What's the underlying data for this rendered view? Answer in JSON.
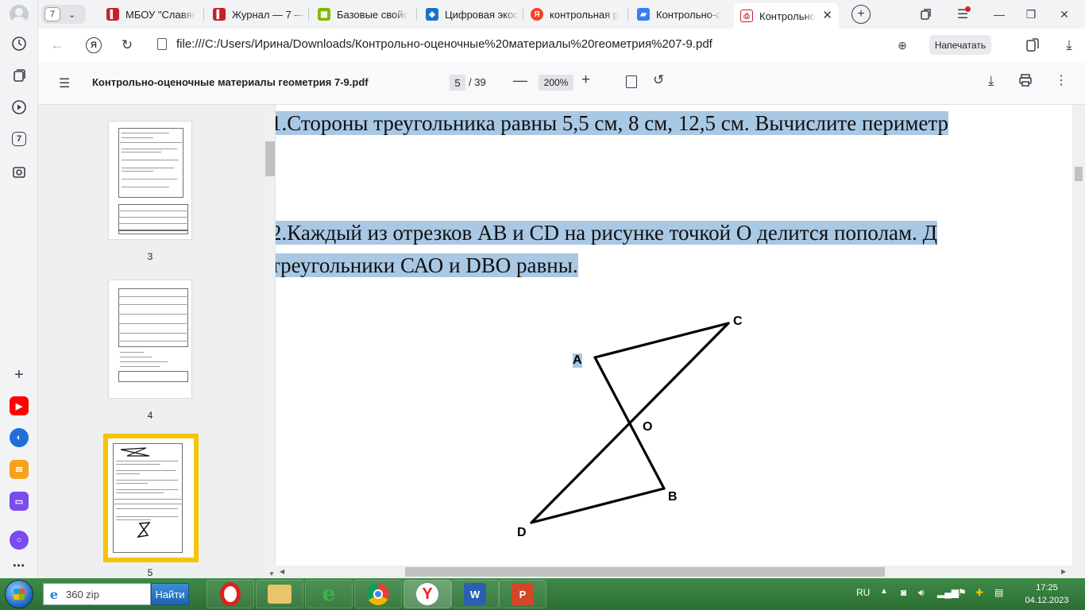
{
  "browser": {
    "tab_group_count": "7",
    "tabs": [
      {
        "label": "МБОУ \"Славян",
        "fav_color": "#c8202a",
        "fav_glyph": "▌"
      },
      {
        "label": "Журнал — 7 —",
        "fav_color": "#c8202a",
        "fav_glyph": "▌"
      },
      {
        "label": "Базовые свойс",
        "fav_color": "#7fba00",
        "fav_glyph": "▦"
      },
      {
        "label": "Цифровая экос",
        "fav_color": "#1a73c8",
        "fav_glyph": "◆"
      },
      {
        "label": "контрольная р",
        "fav_color": "#fc3f1d",
        "fav_glyph": "Я"
      },
      {
        "label": "Контрольно-о",
        "fav_color": "#3b7df2",
        "fav_glyph": "▰"
      },
      {
        "label": "Контрольно",
        "fav_color": "#ffffff",
        "fav_glyph": "⎙"
      }
    ],
    "address": "file:///C:/Users/Ирина/Downloads/Контрольно-оценочные%20материалы%20геометрия%207-9.pdf",
    "print_label": "Напечатать",
    "sidebar_badge": "7"
  },
  "pdf": {
    "title": "Контрольно-оценочные материалы геометрия 7-9.pdf",
    "current_page": "5",
    "total_pages": "/ 39",
    "zoom": "200%",
    "thumbnails": [
      {
        "num": "3"
      },
      {
        "num": "4"
      },
      {
        "num": "5"
      }
    ]
  },
  "document": {
    "line1": "1.Стороны треугольника равны  5,5 см,  8 см,  12,5 см. Вычислите периметр",
    "line2a": "2.Каждый из отрезков АВ  и  ",
    "line2b": "CD",
    "line2c": " на рисунке точкой  О делится пополам. Д",
    "line3a": "треугольники С",
    "line3b": "АО",
    "line3c": " и ",
    "line3d": "DBO",
    "line3e": " равны.",
    "figure_labels": {
      "A": "A",
      "B": "B",
      "C": "C",
      "D": "D",
      "O": "O"
    }
  },
  "taskbar": {
    "search_value": "360 zip",
    "search_button": "Найти",
    "lang": "RU",
    "time": "17:25",
    "date": "04.12.2023"
  }
}
